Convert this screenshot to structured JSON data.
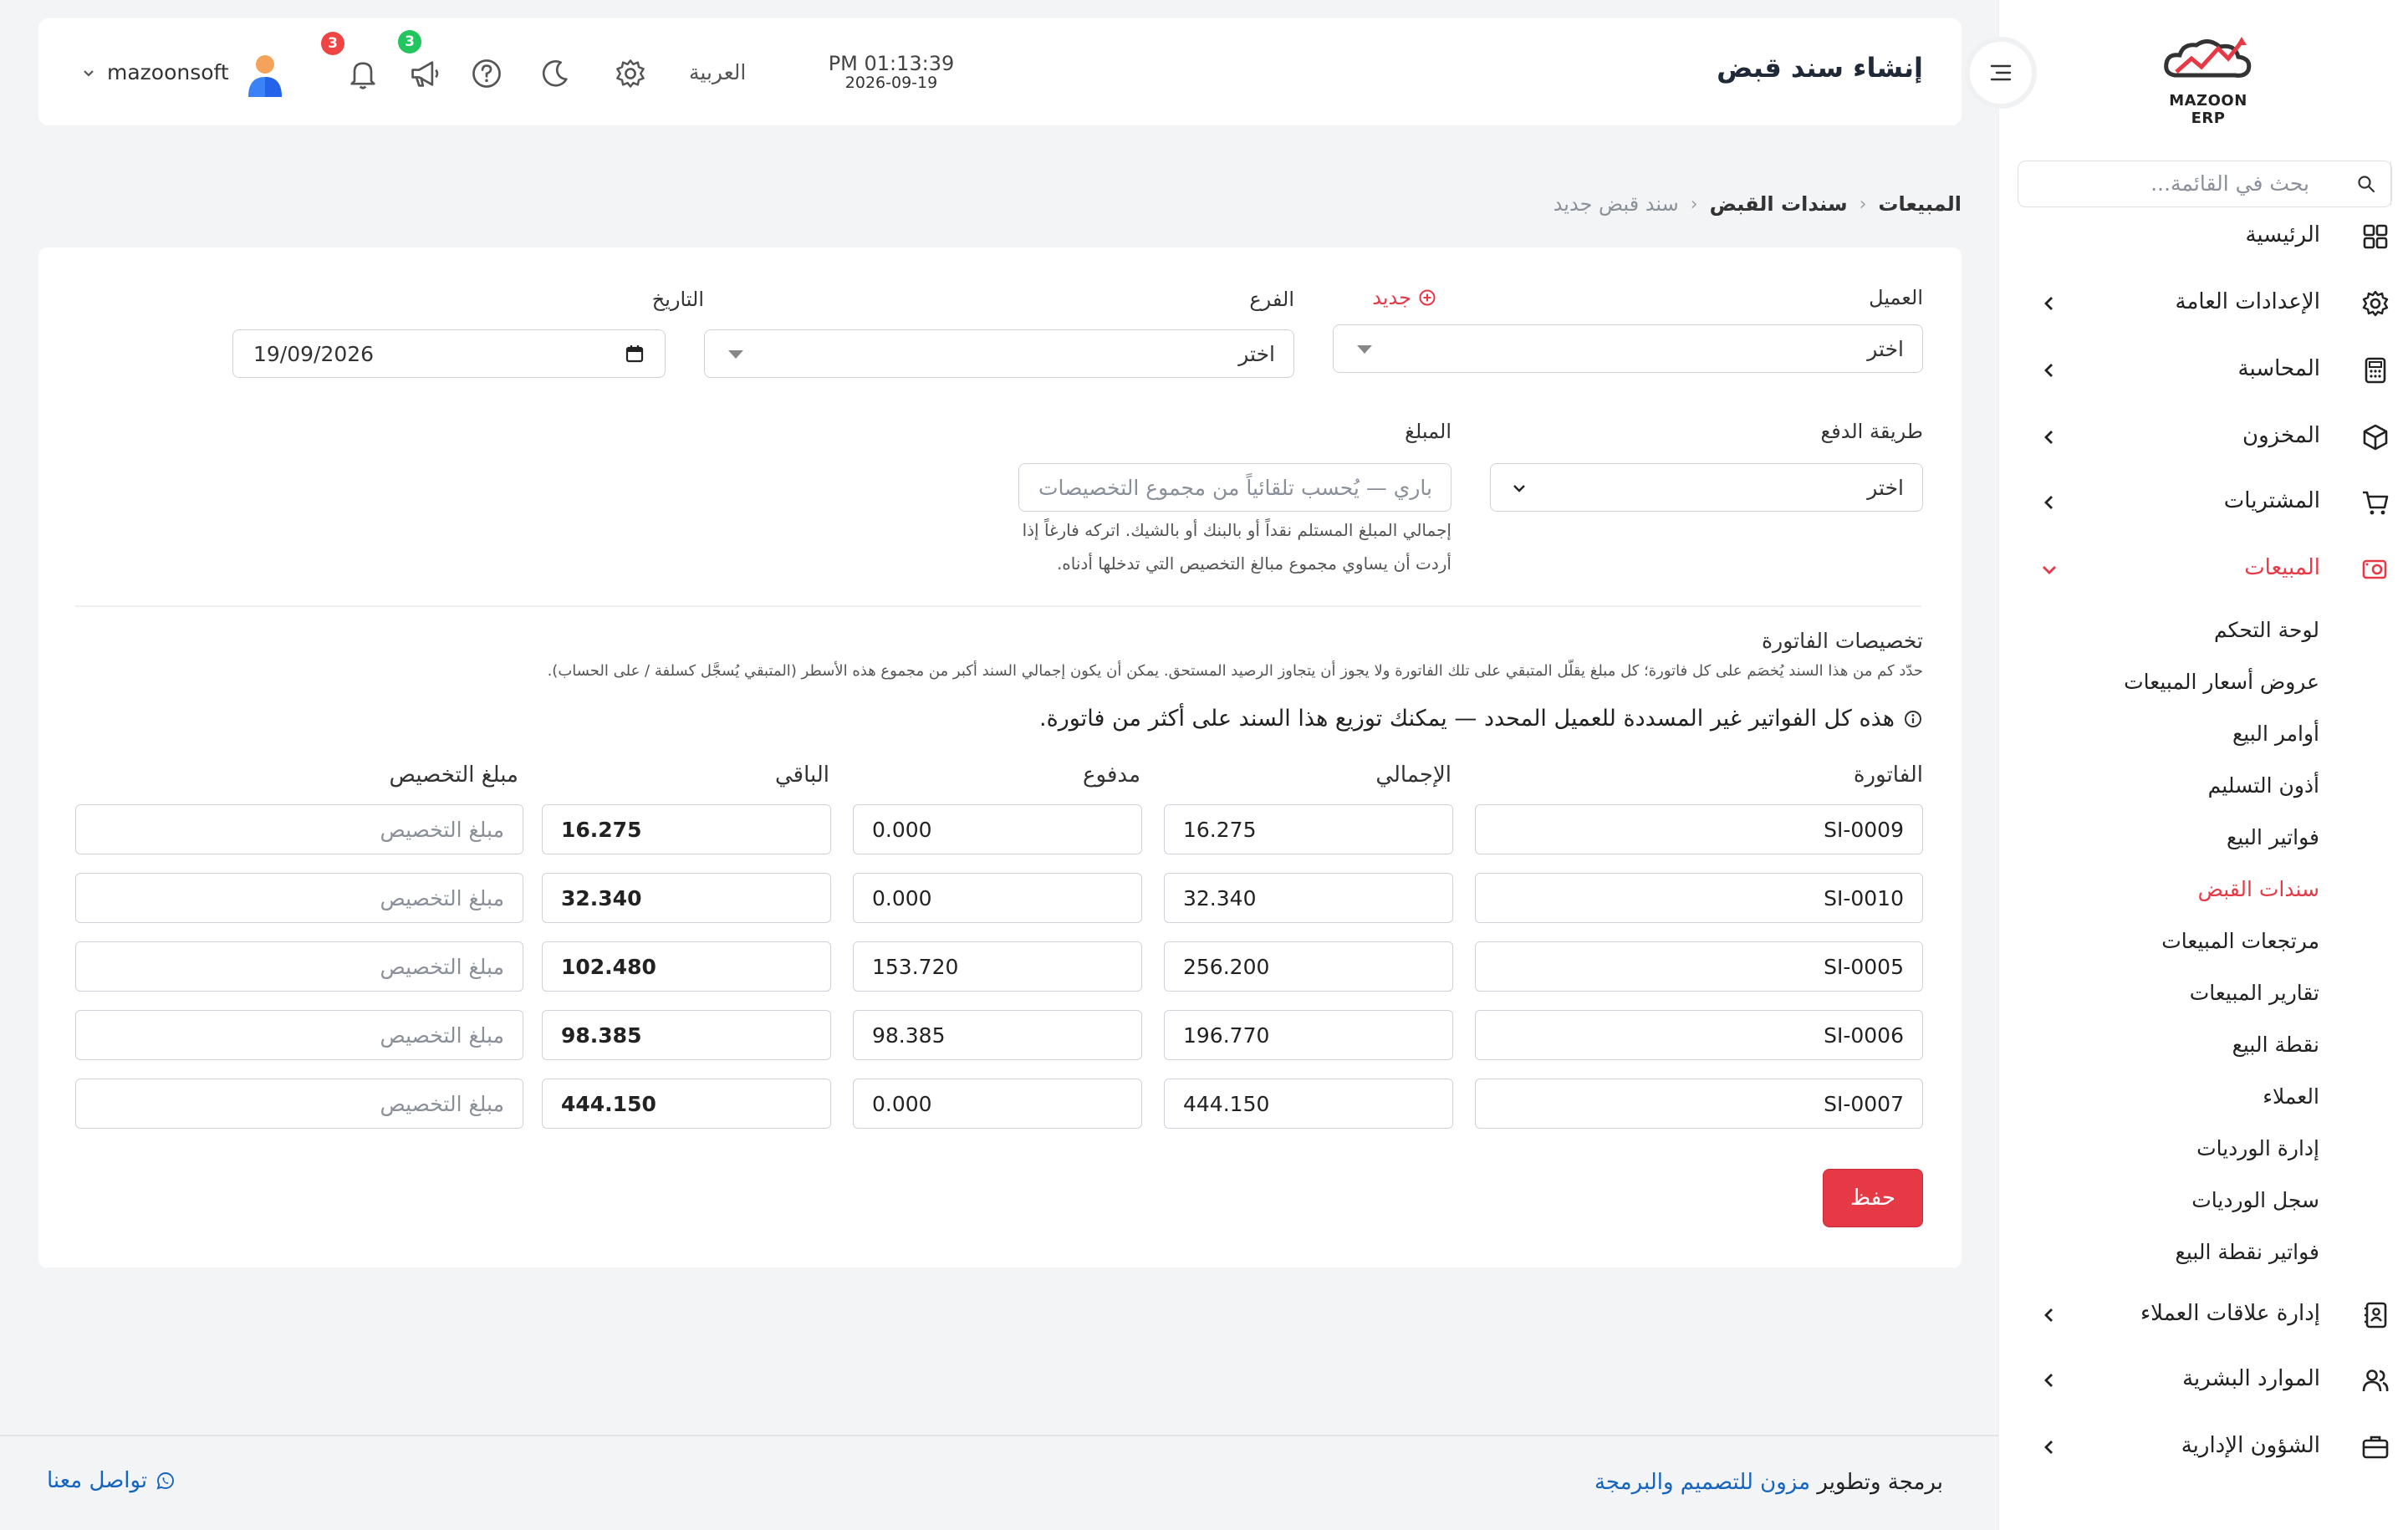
{
  "sidebar": {
    "logo_text": "MAZOON ERP",
    "search_placeholder": "بحث في القائمة...",
    "items": [
      {
        "label": "الرئيسية",
        "icon": "dashboard-grid-icon"
      },
      {
        "label": "الإعدادات العامة",
        "icon": "gear-icon"
      },
      {
        "label": "المحاسبة",
        "icon": "calculator-icon"
      },
      {
        "label": "المخزون",
        "icon": "box-icon"
      },
      {
        "label": "المشتريات",
        "icon": "cart-icon"
      },
      {
        "label": "المبيعات",
        "icon": "sales-icon",
        "active": true
      },
      {
        "label": "إدارة علاقات العملاء",
        "icon": "contacts-icon"
      },
      {
        "label": "الموارد البشرية",
        "icon": "users-icon"
      },
      {
        "label": "الشؤون الإدارية",
        "icon": "briefcase-icon"
      }
    ],
    "sales_sub": [
      "لوحة التحكم",
      "عروض أسعار المبيعات",
      "أوامر البيع",
      "أذون التسليم",
      "فواتير البيع",
      "سندات القبض",
      "مرتجعات المبيعات",
      "تقارير المبيعات",
      "نقطة البيع",
      "العملاء",
      "إدارة الورديات",
      "سجل الورديات",
      "فواتير نقطة البيع"
    ],
    "active_sub": "سندات القبض"
  },
  "header": {
    "title": "إنشاء سند قبض",
    "time": "PM 01:13:39",
    "date": "2026-09-19",
    "language": "العربية",
    "user": "mazoonsoft",
    "announcements_badge": "3",
    "notifications_badge": "3"
  },
  "breadcrumb": [
    "المبيعات",
    "سندات القبض",
    "سند قبض جديد"
  ],
  "form": {
    "customer_label": "العميل",
    "customer_new": "جديد",
    "customer_value": "اختر",
    "branch_label": "الفرع",
    "branch_value": "اختر",
    "date_label": "التاريخ",
    "date_value": "19/09/2026",
    "payment_method_label": "طريقة الدفع",
    "payment_method_value": "اختر",
    "amount_label": "المبلغ",
    "amount_placeholder": "باري — يُحسب تلقائياً من مجموع التخصيصات",
    "amount_help_1": "إجمالي المبلغ المستلم نقداً أو بالبنك أو بالشيك. اتركه فارغاً إذا",
    "amount_help_2": "أردت أن يساوي مجموع مبالغ التخصيص التي تدخلها أدناه."
  },
  "allocations": {
    "title": "تخصيصات الفاتورة",
    "description": "حدّد كم من هذا السند يُخصَم على كل فاتورة؛ كل مبلغ يقلّل المتبقي على تلك الفاتورة ولا يجوز أن يتجاوز الرصيد المستحق. يمكن أن يكون إجمالي السند أكبر من مجموع هذه الأسطر (المتبقي يُسجَّل كسلفة / على الحساب).",
    "info": "هذه كل الفواتير غير المسددة للعميل المحدد — يمكنك توزيع هذا السند على أكثر من فاتورة.",
    "columns": [
      "الفاتورة",
      "الإجمالي",
      "مدفوع",
      "الباقي",
      "مبلغ التخصيص"
    ],
    "allocation_placeholder": "مبلغ التخصيص",
    "rows": [
      {
        "invoice": "SI-0009",
        "total": "16.275",
        "paid": "0.000",
        "remaining": "16.275"
      },
      {
        "invoice": "SI-0010",
        "total": "32.340",
        "paid": "0.000",
        "remaining": "32.340"
      },
      {
        "invoice": "SI-0005",
        "total": "256.200",
        "paid": "153.720",
        "remaining": "102.480"
      },
      {
        "invoice": "SI-0006",
        "total": "196.770",
        "paid": "98.385",
        "remaining": "98.385"
      },
      {
        "invoice": "SI-0007",
        "total": "444.150",
        "paid": "0.000",
        "remaining": "444.150"
      }
    ]
  },
  "save_label": "حفظ",
  "footer": {
    "credit_prefix": "برمجة وتطوير",
    "credit_link": "مزون للتصميم والبرمجة",
    "contact": "تواصل معنا"
  },
  "colors": {
    "accent": "#e63946",
    "link": "#1565c0",
    "success": "#22c55e"
  }
}
